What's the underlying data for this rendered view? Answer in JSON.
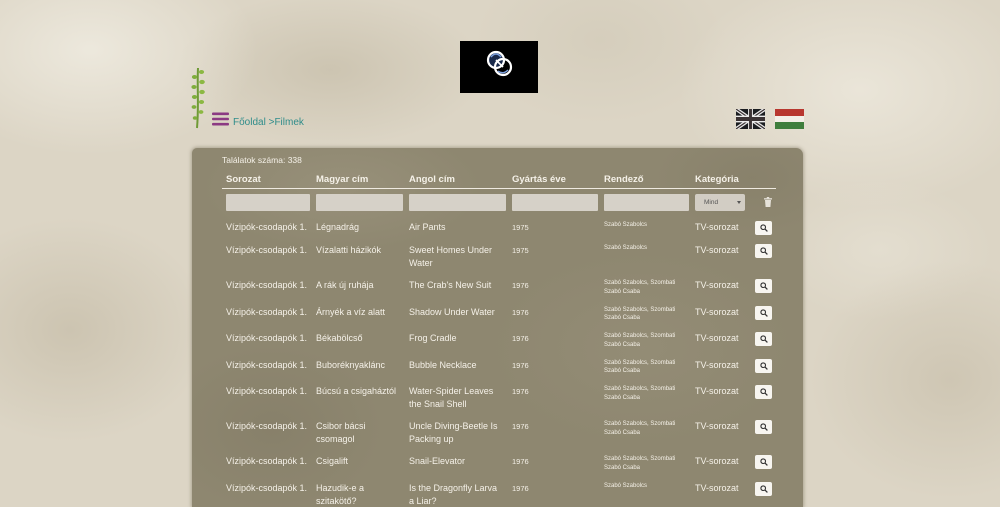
{
  "breadcrumb": {
    "home": "Főoldal",
    "separator": ">",
    "current": "Filmek"
  },
  "icons": {
    "logo": "studio-logo",
    "plant": "plant-decoration-icon",
    "menu": "hamburger-menu-icon",
    "language_english": "uk-flag-icon",
    "language_hungarian": "hungarian-flag-icon",
    "clear_filters": "trash-icon",
    "view": "search-icon"
  },
  "results": {
    "label": "Találatok száma:",
    "count": "338"
  },
  "table": {
    "columns": [
      "Sorozat",
      "Magyar cím",
      "Angol cím",
      "Gyártás éve",
      "Rendező",
      "Kategória"
    ],
    "filters": {
      "series": "",
      "title_hu": "",
      "title_en": "",
      "year": "",
      "director": "",
      "category": "Mind"
    },
    "rows": [
      {
        "series": "Vízipók-csodapók 1.",
        "title_hu": "Légnadrág",
        "title_en": "Air Pants",
        "year": "1975",
        "director": "Szabó Szabolcs",
        "category": "TV-sorozat"
      },
      {
        "series": "Vízipók-csodapók 1.",
        "title_hu": "Vízalatti házikók",
        "title_en": "Sweet Homes Under Water",
        "year": "1975",
        "director": "Szabó Szabolcs",
        "category": "TV-sorozat"
      },
      {
        "series": "Vízipók-csodapók 1.",
        "title_hu": "A rák új ruhája",
        "title_en": "The Crab's New Suit",
        "year": "1976",
        "director": "Szabó Szabolcs, Szombati Szabó Csaba",
        "category": "TV-sorozat"
      },
      {
        "series": "Vízipók-csodapók 1.",
        "title_hu": "Árnyék a víz alatt",
        "title_en": "Shadow Under Water",
        "year": "1976",
        "director": "Szabó Szabolcs, Szombati Szabó Csaba",
        "category": "TV-sorozat"
      },
      {
        "series": "Vízipók-csodapók 1.",
        "title_hu": "Békabölcső",
        "title_en": "Frog Cradle",
        "year": "1976",
        "director": "Szabó Szabolcs, Szombati Szabó Csaba",
        "category": "TV-sorozat"
      },
      {
        "series": "Vízipók-csodapók 1.",
        "title_hu": "Buboréknyaklánc",
        "title_en": "Bubble Necklace",
        "year": "1976",
        "director": "Szabó Szabolcs, Szombati Szabó Csaba",
        "category": "TV-sorozat"
      },
      {
        "series": "Vízipók-csodapók 1.",
        "title_hu": "Búcsú a csigaháztól",
        "title_en": "Water-Spider Leaves the Snail Shell",
        "year": "1976",
        "director": "Szabó Szabolcs, Szombati Szabó Csaba",
        "category": "TV-sorozat"
      },
      {
        "series": "Vízipók-csodapók 1.",
        "title_hu": "Csibor bácsi csomagol",
        "title_en": "Uncle Diving-Beetle Is Packing up",
        "year": "1976",
        "director": "Szabó Szabolcs, Szombati Szabó Csaba",
        "category": "TV-sorozat"
      },
      {
        "series": "Vízipók-csodapók 1.",
        "title_hu": "Csigalift",
        "title_en": "Snail-Elevator",
        "year": "1976",
        "director": "Szabó Szabolcs, Szombati Szabó Csaba",
        "category": "TV-sorozat"
      },
      {
        "series": "Vízipók-csodapók 1.",
        "title_hu": "Hazudik-e a szitakötő?",
        "title_en": "Is the Dragonfly Larva a Liar?",
        "year": "1976",
        "director": "Szabó Szabolcs",
        "category": "TV-sorozat"
      }
    ]
  },
  "colors": {
    "background": "#dcd5c5",
    "panel": "#8e8770",
    "text": "#f5f1e8",
    "breadcrumb": "#2e8c8a",
    "menu": "#8b3a83",
    "input": "#d6d1c8",
    "plant": "#7aa53a"
  }
}
